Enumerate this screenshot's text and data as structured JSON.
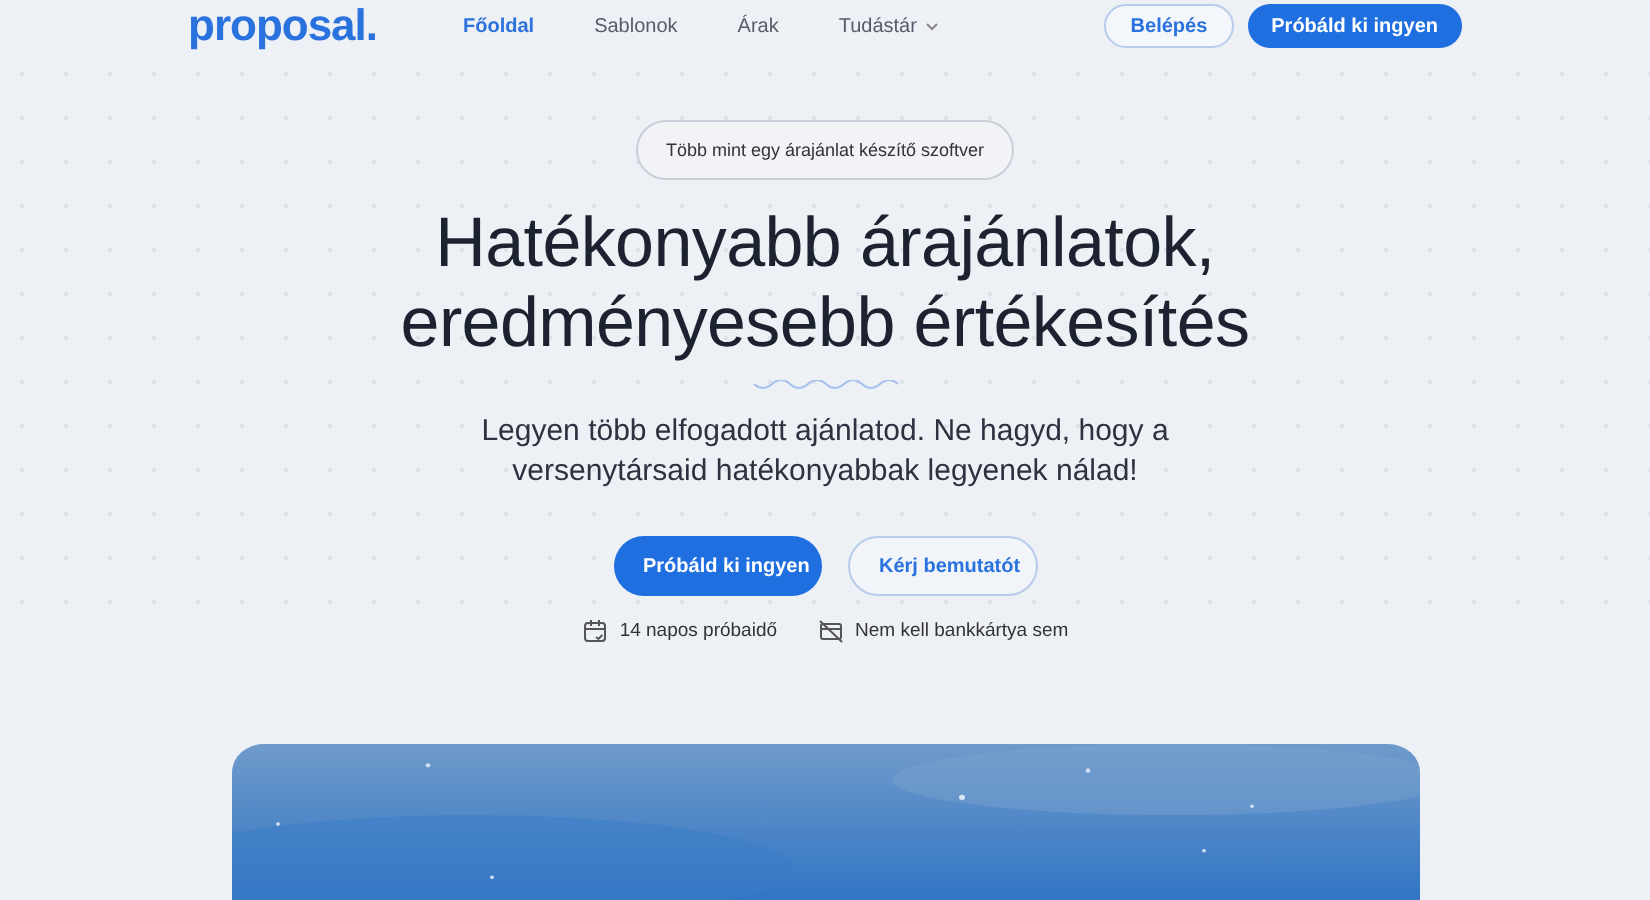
{
  "header": {
    "logo": "proposal.",
    "nav": [
      {
        "label": "Főoldal",
        "selected": true,
        "dropdown": false
      },
      {
        "label": "Sablonok",
        "selected": false,
        "dropdown": false
      },
      {
        "label": "Árak",
        "selected": false,
        "dropdown": false
      },
      {
        "label": "Tudástár",
        "selected": false,
        "dropdown": true
      }
    ],
    "login": "Belépés",
    "cta": "Próbáld ki ingyen"
  },
  "hero": {
    "badge": "Több mint egy árajánlat készítő szoftver",
    "title_lines": [
      "Hatékonyabb árajánlatok,",
      "eredményesebb értékesítés"
    ],
    "subtitle": "Legyen több elfogadott ajánlatod. Ne hagyd, hogy a versenytársaid hatékonyabbak legyenek nálad!",
    "buttons": [
      {
        "label": "Próbáld ki ingyen",
        "kind": "primary"
      },
      {
        "label": "Kérj bemutatót",
        "kind": "outline"
      }
    ],
    "features": [
      {
        "label": "14 napos próbaidő",
        "kind": "calendar"
      },
      {
        "label": "Nem kell bankkártya sem",
        "kind": "card"
      }
    ]
  }
}
